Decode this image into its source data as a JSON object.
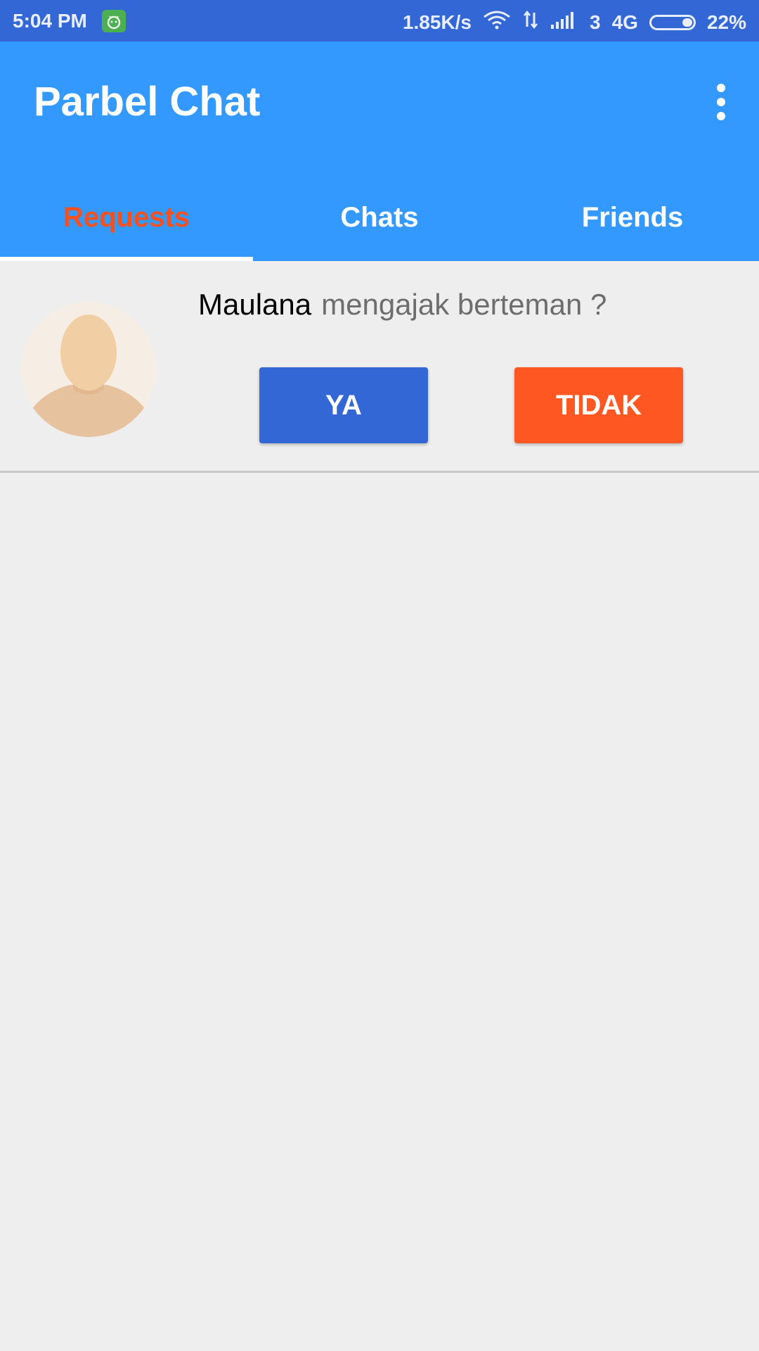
{
  "status_bar": {
    "time": "5:04 PM",
    "net_speed": "1.85K/s",
    "carrier_num": "3",
    "network_type": "4G",
    "battery": "22%"
  },
  "app_bar": {
    "title": "Parbel Chat",
    "menu_icon": "more-vert-icon"
  },
  "tabs": [
    {
      "label": "Requests",
      "active": true
    },
    {
      "label": "Chats",
      "active": false
    },
    {
      "label": "Friends",
      "active": false
    }
  ],
  "requests": [
    {
      "name": "Maulana",
      "message": "mengajak berteman ?",
      "accept_label": "YA",
      "reject_label": "TIDAK"
    }
  ],
  "colors": {
    "status_bar": "#3367d6",
    "app_bar": "#3399ff",
    "active_tab": "#f4511e",
    "accept": "#3367d6",
    "reject": "#ff5722",
    "background": "#eeeeee"
  }
}
